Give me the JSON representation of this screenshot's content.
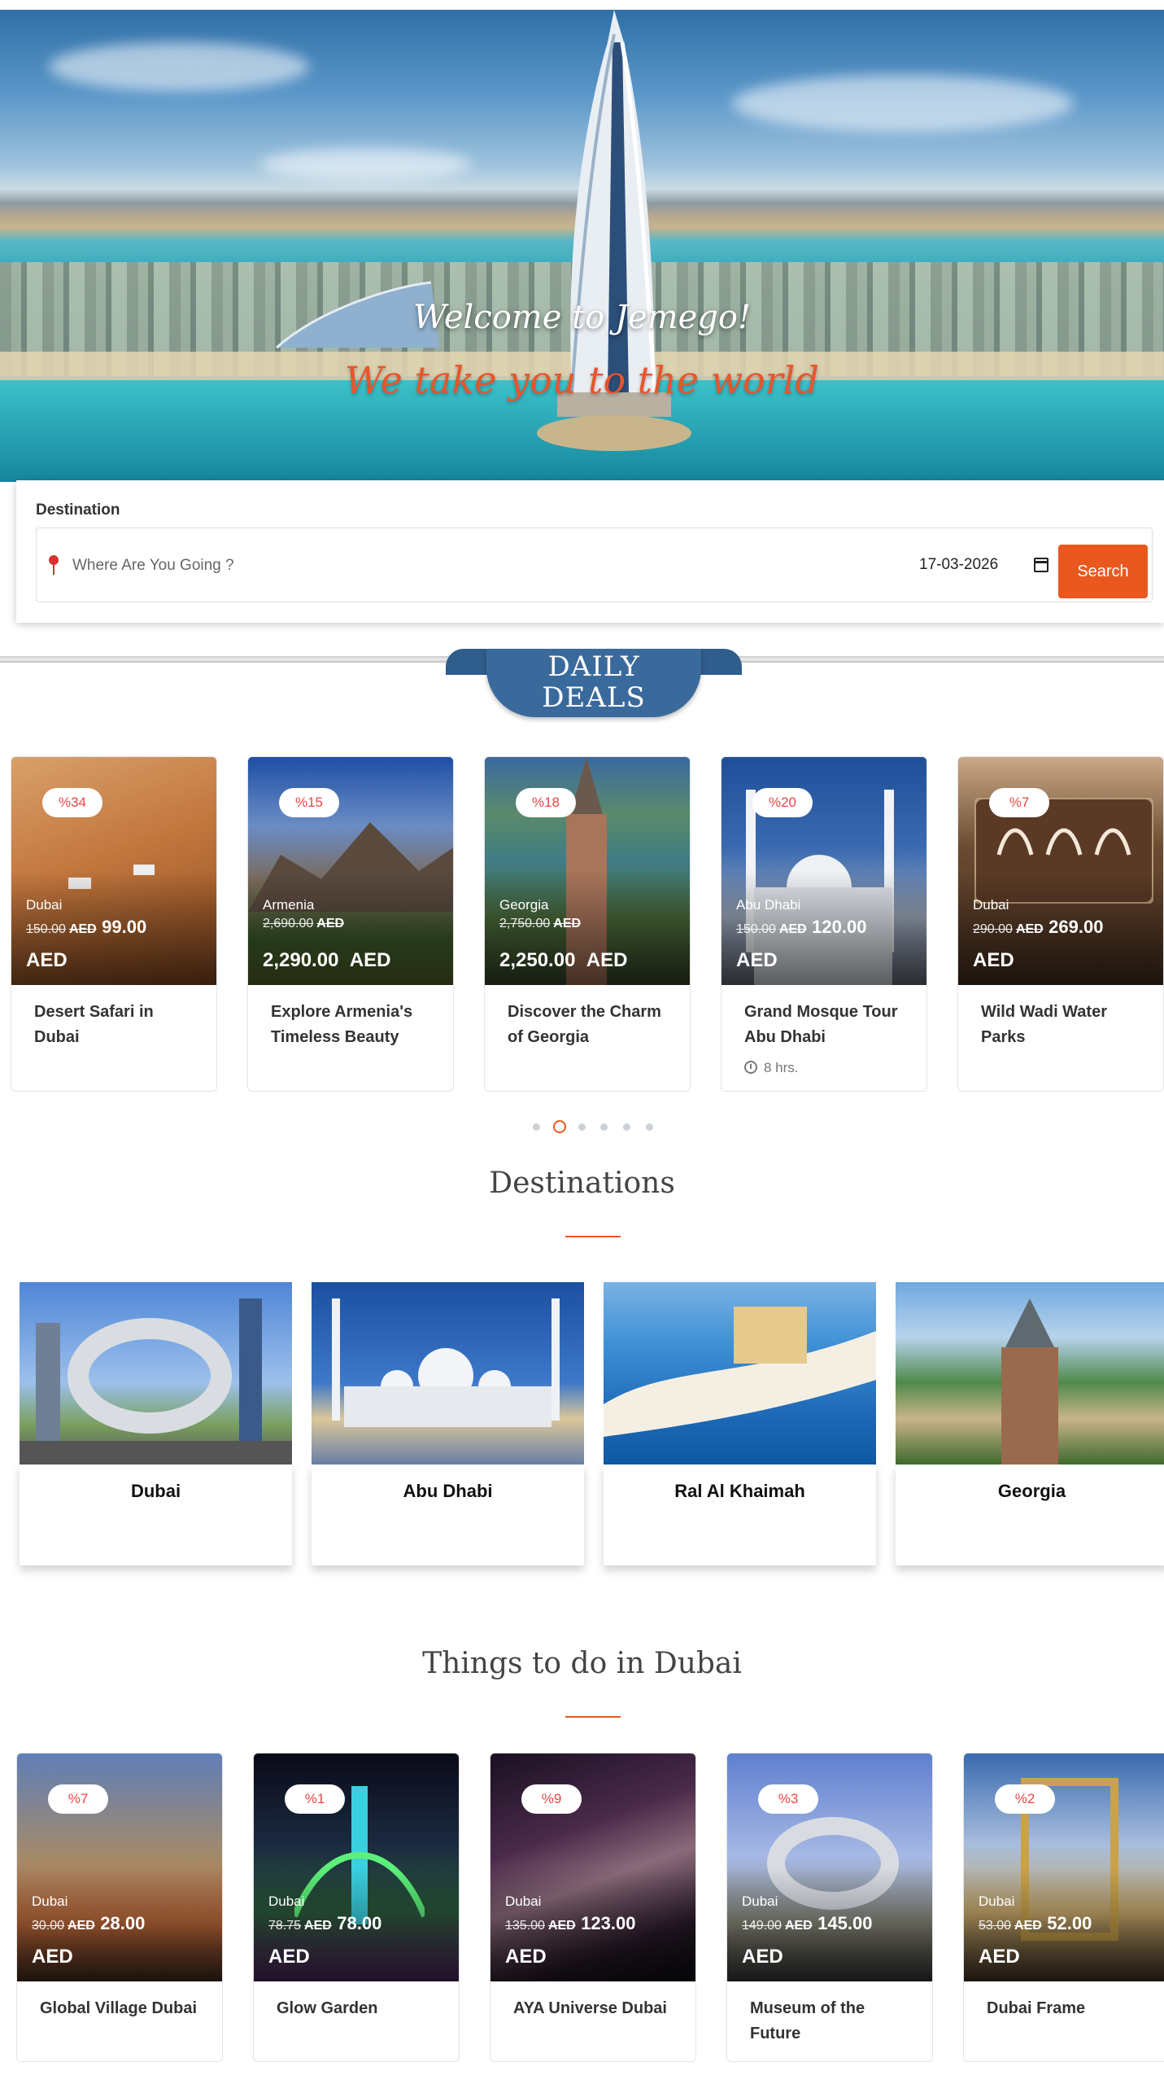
{
  "hero": {
    "title": "Welcome to Jemego!",
    "subtitle": "We take you to the world"
  },
  "search": {
    "label": "Destination",
    "placeholder": "Where Are You Going ?",
    "date": "17-03-2026",
    "button": "Search"
  },
  "daily_deals": {
    "line1": "DAILY",
    "line2": "DEALS",
    "cards": [
      {
        "discount": "%34",
        "location": "Dubai",
        "old_price": "150.00",
        "currency": "AED",
        "new_price": "99.00",
        "title": "Desert Safari in Dubai",
        "duration": ""
      },
      {
        "discount": "%15",
        "location": "Armenia",
        "old_price": "2,690.00",
        "currency": "AED",
        "new_price": "2,290.00",
        "title": "Explore Armenia's Timeless Beauty",
        "duration": ""
      },
      {
        "discount": "%18",
        "location": "Georgia",
        "old_price": "2,750.00",
        "currency": "AED",
        "new_price": "2,250.00",
        "title": "Discover the Charm of Georgia",
        "duration": ""
      },
      {
        "discount": "%20",
        "location": "Abu Dhabi",
        "old_price": "150.00",
        "currency": "AED",
        "new_price": "120.00",
        "title": "Grand Mosque Tour Abu Dhabi",
        "duration": "8 hrs."
      },
      {
        "discount": "%7",
        "location": "Dubai",
        "old_price": "290.00",
        "currency": "AED",
        "new_price": "269.00",
        "title": "Wild Wadi Water Parks",
        "duration": ""
      }
    ],
    "pagination": {
      "pages": 6,
      "active": 2
    }
  },
  "destinations": {
    "title": "Destinations",
    "items": [
      {
        "name": "Dubai"
      },
      {
        "name": "Abu Dhabi"
      },
      {
        "name": "Ral Al Khaimah"
      },
      {
        "name": "Georgia"
      }
    ]
  },
  "things_to_do": {
    "title": "Things to do in Dubai",
    "cards": [
      {
        "discount": "%7",
        "location": "Dubai",
        "old_price": "30.00",
        "currency": "AED",
        "new_price": "28.00",
        "title": "Global Village Dubai"
      },
      {
        "discount": "%1",
        "location": "Dubai",
        "old_price": "78.75",
        "currency": "AED",
        "new_price": "78.00",
        "title": "Glow Garden"
      },
      {
        "discount": "%9",
        "location": "Dubai",
        "old_price": "135.00",
        "currency": "AED",
        "new_price": "123.00",
        "title": "AYA Universe Dubai"
      },
      {
        "discount": "%3",
        "location": "Dubai",
        "old_price": "149.00",
        "currency": "AED",
        "new_price": "145.00",
        "title": "Museum of the Future"
      },
      {
        "discount": "%2",
        "location": "Dubai",
        "old_price": "53.00",
        "currency": "AED",
        "new_price": "52.00",
        "title": "Dubai Frame"
      }
    ]
  },
  "colors": {
    "accent": "#e9581f",
    "badge_text": "#e44444",
    "ribbon": "#3a6a9c"
  }
}
